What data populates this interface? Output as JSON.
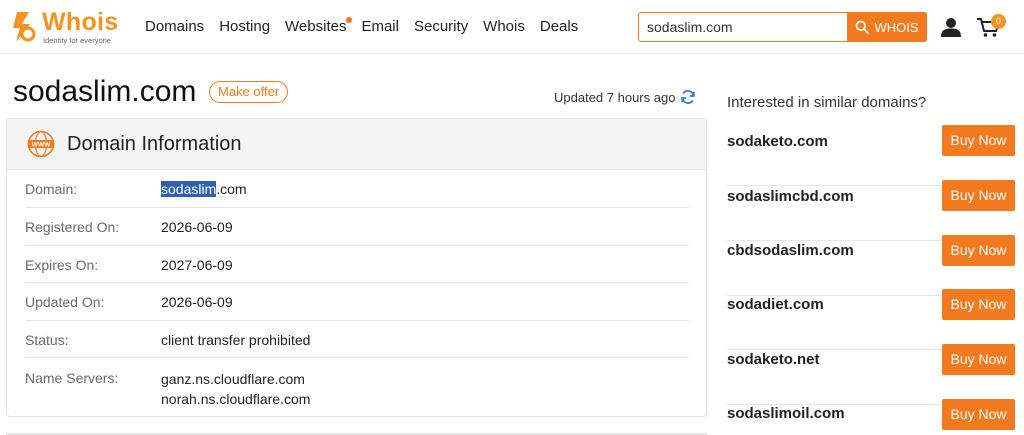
{
  "header": {
    "logo": {
      "word": "Whois",
      "tagline": "Identity for everyone"
    },
    "nav": [
      {
        "label": "Domains"
      },
      {
        "label": "Hosting"
      },
      {
        "label": "Websites",
        "has_dot": true
      },
      {
        "label": "Email"
      },
      {
        "label": "Security"
      },
      {
        "label": "Whois"
      },
      {
        "label": "Deals"
      }
    ],
    "search": {
      "value": "sodaslim.com",
      "button_label": "WHOIS"
    },
    "cart_count": "0"
  },
  "main": {
    "domain": "sodaslim.com",
    "make_offer_label": "Make offer",
    "updated_text": "Updated 7 hours ago",
    "card": {
      "title": "Domain Information",
      "domain_label": "Domain:",
      "domain_name": "sodaslim",
      "domain_tld": ".com",
      "rows": [
        {
          "label": "Registered On:",
          "value": "2026-06-09"
        },
        {
          "label": "Expires On:",
          "value": "2027-06-09"
        },
        {
          "label": "Updated On:",
          "value": "2026-06-09"
        },
        {
          "label": "Status:",
          "value": "client transfer prohibited"
        }
      ],
      "ns_label": "Name Servers:",
      "name_servers": [
        "ganz.ns.cloudflare.com",
        "norah.ns.cloudflare.com"
      ]
    }
  },
  "sidebar": {
    "title": "Interested in similar domains?",
    "buy_label": "Buy Now",
    "domains": [
      "sodaketo.com",
      "sodaslimcbd.com",
      "cbdsodaslim.com",
      "sodadiet.com",
      "sodaketo.net",
      "sodaslimoil.com"
    ]
  },
  "colors": {
    "accent": "#f47a20",
    "logo": "#f7921e",
    "selection": "#2f5fb3"
  },
  "icons": [
    "logo-mark-icon",
    "search-icon",
    "user-icon",
    "cart-icon",
    "refresh-icon",
    "www-icon"
  ]
}
